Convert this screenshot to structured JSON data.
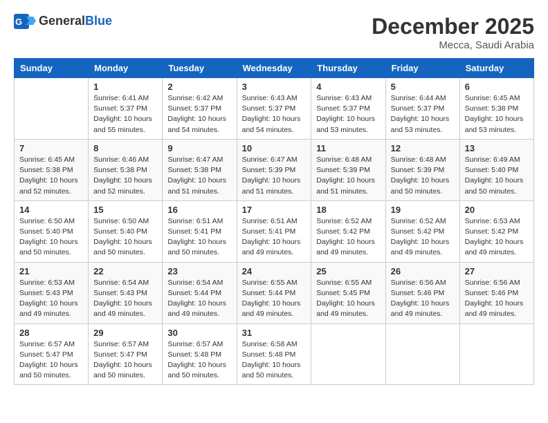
{
  "header": {
    "logo_general": "General",
    "logo_blue": "Blue",
    "month_title": "December 2025",
    "location": "Mecca, Saudi Arabia"
  },
  "weekdays": [
    "Sunday",
    "Monday",
    "Tuesday",
    "Wednesday",
    "Thursday",
    "Friday",
    "Saturday"
  ],
  "weeks": [
    [
      {
        "day": "",
        "sunrise": "",
        "sunset": "",
        "daylight": ""
      },
      {
        "day": "1",
        "sunrise": "Sunrise: 6:41 AM",
        "sunset": "Sunset: 5:37 PM",
        "daylight": "Daylight: 10 hours and 55 minutes."
      },
      {
        "day": "2",
        "sunrise": "Sunrise: 6:42 AM",
        "sunset": "Sunset: 5:37 PM",
        "daylight": "Daylight: 10 hours and 54 minutes."
      },
      {
        "day": "3",
        "sunrise": "Sunrise: 6:43 AM",
        "sunset": "Sunset: 5:37 PM",
        "daylight": "Daylight: 10 hours and 54 minutes."
      },
      {
        "day": "4",
        "sunrise": "Sunrise: 6:43 AM",
        "sunset": "Sunset: 5:37 PM",
        "daylight": "Daylight: 10 hours and 53 minutes."
      },
      {
        "day": "5",
        "sunrise": "Sunrise: 6:44 AM",
        "sunset": "Sunset: 5:37 PM",
        "daylight": "Daylight: 10 hours and 53 minutes."
      },
      {
        "day": "6",
        "sunrise": "Sunrise: 6:45 AM",
        "sunset": "Sunset: 5:38 PM",
        "daylight": "Daylight: 10 hours and 53 minutes."
      }
    ],
    [
      {
        "day": "7",
        "sunrise": "Sunrise: 6:45 AM",
        "sunset": "Sunset: 5:38 PM",
        "daylight": "Daylight: 10 hours and 52 minutes."
      },
      {
        "day": "8",
        "sunrise": "Sunrise: 6:46 AM",
        "sunset": "Sunset: 5:38 PM",
        "daylight": "Daylight: 10 hours and 52 minutes."
      },
      {
        "day": "9",
        "sunrise": "Sunrise: 6:47 AM",
        "sunset": "Sunset: 5:38 PM",
        "daylight": "Daylight: 10 hours and 51 minutes."
      },
      {
        "day": "10",
        "sunrise": "Sunrise: 6:47 AM",
        "sunset": "Sunset: 5:39 PM",
        "daylight": "Daylight: 10 hours and 51 minutes."
      },
      {
        "day": "11",
        "sunrise": "Sunrise: 6:48 AM",
        "sunset": "Sunset: 5:39 PM",
        "daylight": "Daylight: 10 hours and 51 minutes."
      },
      {
        "day": "12",
        "sunrise": "Sunrise: 6:48 AM",
        "sunset": "Sunset: 5:39 PM",
        "daylight": "Daylight: 10 hours and 50 minutes."
      },
      {
        "day": "13",
        "sunrise": "Sunrise: 6:49 AM",
        "sunset": "Sunset: 5:40 PM",
        "daylight": "Daylight: 10 hours and 50 minutes."
      }
    ],
    [
      {
        "day": "14",
        "sunrise": "Sunrise: 6:50 AM",
        "sunset": "Sunset: 5:40 PM",
        "daylight": "Daylight: 10 hours and 50 minutes."
      },
      {
        "day": "15",
        "sunrise": "Sunrise: 6:50 AM",
        "sunset": "Sunset: 5:40 PM",
        "daylight": "Daylight: 10 hours and 50 minutes."
      },
      {
        "day": "16",
        "sunrise": "Sunrise: 6:51 AM",
        "sunset": "Sunset: 5:41 PM",
        "daylight": "Daylight: 10 hours and 50 minutes."
      },
      {
        "day": "17",
        "sunrise": "Sunrise: 6:51 AM",
        "sunset": "Sunset: 5:41 PM",
        "daylight": "Daylight: 10 hours and 49 minutes."
      },
      {
        "day": "18",
        "sunrise": "Sunrise: 6:52 AM",
        "sunset": "Sunset: 5:42 PM",
        "daylight": "Daylight: 10 hours and 49 minutes."
      },
      {
        "day": "19",
        "sunrise": "Sunrise: 6:52 AM",
        "sunset": "Sunset: 5:42 PM",
        "daylight": "Daylight: 10 hours and 49 minutes."
      },
      {
        "day": "20",
        "sunrise": "Sunrise: 6:53 AM",
        "sunset": "Sunset: 5:42 PM",
        "daylight": "Daylight: 10 hours and 49 minutes."
      }
    ],
    [
      {
        "day": "21",
        "sunrise": "Sunrise: 6:53 AM",
        "sunset": "Sunset: 5:43 PM",
        "daylight": "Daylight: 10 hours and 49 minutes."
      },
      {
        "day": "22",
        "sunrise": "Sunrise: 6:54 AM",
        "sunset": "Sunset: 5:43 PM",
        "daylight": "Daylight: 10 hours and 49 minutes."
      },
      {
        "day": "23",
        "sunrise": "Sunrise: 6:54 AM",
        "sunset": "Sunset: 5:44 PM",
        "daylight": "Daylight: 10 hours and 49 minutes."
      },
      {
        "day": "24",
        "sunrise": "Sunrise: 6:55 AM",
        "sunset": "Sunset: 5:44 PM",
        "daylight": "Daylight: 10 hours and 49 minutes."
      },
      {
        "day": "25",
        "sunrise": "Sunrise: 6:55 AM",
        "sunset": "Sunset: 5:45 PM",
        "daylight": "Daylight: 10 hours and 49 minutes."
      },
      {
        "day": "26",
        "sunrise": "Sunrise: 6:56 AM",
        "sunset": "Sunset: 5:46 PM",
        "daylight": "Daylight: 10 hours and 49 minutes."
      },
      {
        "day": "27",
        "sunrise": "Sunrise: 6:56 AM",
        "sunset": "Sunset: 5:46 PM",
        "daylight": "Daylight: 10 hours and 49 minutes."
      }
    ],
    [
      {
        "day": "28",
        "sunrise": "Sunrise: 6:57 AM",
        "sunset": "Sunset: 5:47 PM",
        "daylight": "Daylight: 10 hours and 50 minutes."
      },
      {
        "day": "29",
        "sunrise": "Sunrise: 6:57 AM",
        "sunset": "Sunset: 5:47 PM",
        "daylight": "Daylight: 10 hours and 50 minutes."
      },
      {
        "day": "30",
        "sunrise": "Sunrise: 6:57 AM",
        "sunset": "Sunset: 5:48 PM",
        "daylight": "Daylight: 10 hours and 50 minutes."
      },
      {
        "day": "31",
        "sunrise": "Sunrise: 6:58 AM",
        "sunset": "Sunset: 5:48 PM",
        "daylight": "Daylight: 10 hours and 50 minutes."
      },
      {
        "day": "",
        "sunrise": "",
        "sunset": "",
        "daylight": ""
      },
      {
        "day": "",
        "sunrise": "",
        "sunset": "",
        "daylight": ""
      },
      {
        "day": "",
        "sunrise": "",
        "sunset": "",
        "daylight": ""
      }
    ]
  ]
}
